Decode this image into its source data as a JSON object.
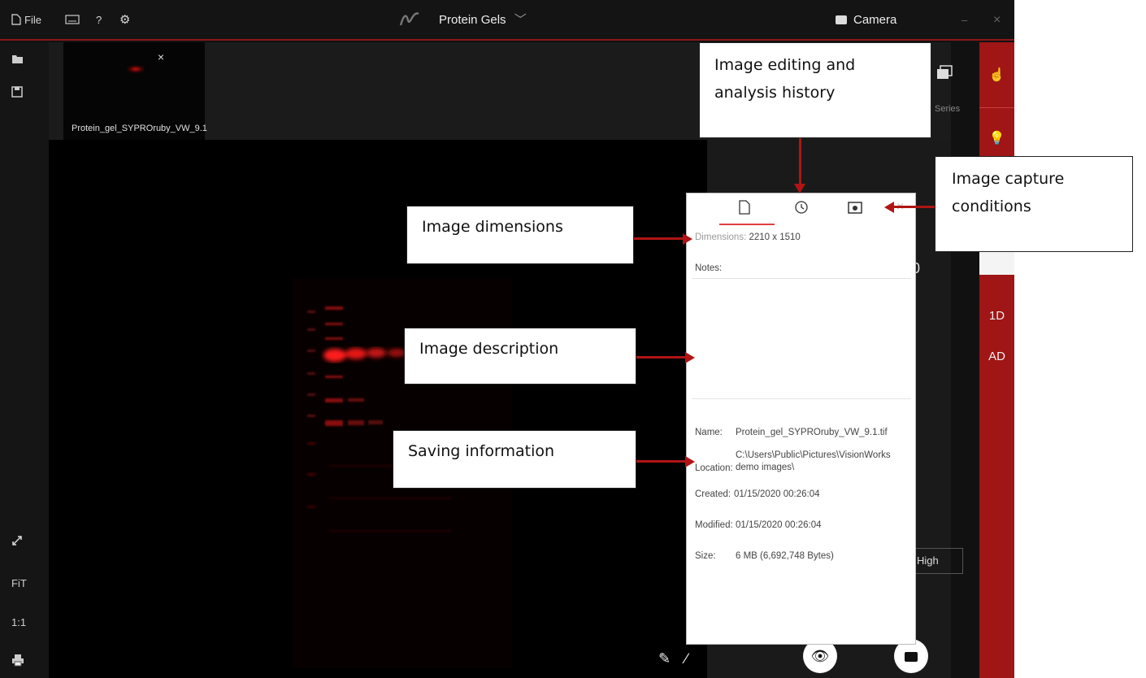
{
  "titlebar": {
    "file_label": "File",
    "help_label": "?",
    "app_title": "Protein Gels",
    "camera_label": "Camera",
    "minimize_label": "–",
    "close_label": "×"
  },
  "thumbnail": {
    "name": "Protein_gel_SYPROruby_VW_9.1",
    "close_label": "×"
  },
  "left_toolbar": {
    "fit_label": "FiT",
    "one_to_one_label": "1:1"
  },
  "right_panel": {
    "series_label": "Series",
    "high_label": "High",
    "partial_value": "0"
  },
  "red_sidebar": {
    "oned_label": "1D",
    "ad_label": "AD"
  },
  "info_panel": {
    "dimensions_label": "Dimensions:",
    "dimensions_value": "2210 x 1510",
    "notes_label": "Notes:",
    "close_label": "×",
    "name_label": "Name:",
    "name_value": "Protein_gel_SYPROruby_VW_9.1.tif",
    "location_label": "Location:",
    "location_value_line1": "C:\\Users\\Public\\Pictures\\VisionWorks",
    "location_value_line2": "demo images\\",
    "created_label": "Created:",
    "created_value": "01/15/2020 00:26:04",
    "modified_label": "Modified:",
    "modified_value": "01/15/2020 00:26:04",
    "size_label": "Size:",
    "size_value": "6 MB (6,692,748 Bytes)"
  },
  "callouts": {
    "history_line1": "Image editing and",
    "history_line2": "analysis history",
    "capture_line1": "Image capture",
    "capture_line2": "conditions",
    "dimensions": "Image dimensions",
    "description": "Image description",
    "saving": "Saving information"
  },
  "colors": {
    "accent_red": "#a01515",
    "arrow_red": "#b01414",
    "background_dark": "#111111"
  }
}
